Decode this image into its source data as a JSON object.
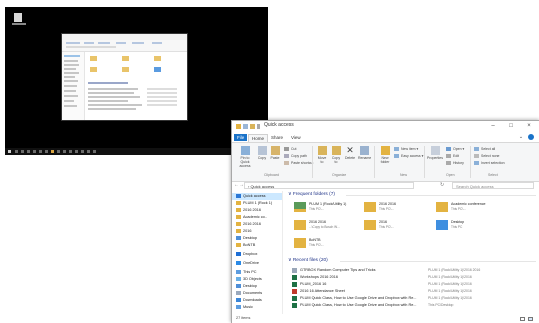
{
  "window": {
    "title": "Quick access",
    "tabs": [
      "File",
      "Home",
      "Share",
      "View"
    ],
    "controls": [
      "–",
      "□",
      "×"
    ]
  },
  "ribbon": {
    "clipboard": {
      "group_label": "Clipboard",
      "pin": "Pin to Quick access",
      "copy": "Copy",
      "paste": "Paste",
      "cut": "Cut",
      "copy_path": "Copy path",
      "paste_shortcut": "Paste shortcut"
    },
    "organize": {
      "group_label": "Organize",
      "move_to": "Move to",
      "copy_to": "Copy to",
      "delete": "Delete",
      "rename": "Rename"
    },
    "new": {
      "group_label": "New",
      "new_folder": "New folder",
      "new_item": "New item ▾",
      "easy_access": "Easy access ▾"
    },
    "open": {
      "group_label": "Open",
      "properties": "Properties",
      "open": "Open ▾",
      "edit": "Edit",
      "history": "History"
    },
    "select": {
      "group_label": "Select",
      "select_all": "Select all",
      "select_none": "Select none",
      "invert": "Invert selection"
    }
  },
  "address": {
    "path": "›  Quick access",
    "search_placeholder": "Search Quick access"
  },
  "nav": {
    "items": [
      {
        "label": "Quick access",
        "selected": true
      },
      {
        "label": "PLUM 1 (Rock 1)"
      },
      {
        "label": "2016 2016"
      },
      {
        "label": "Academic co.."
      },
      {
        "label": "2016 2016"
      },
      {
        "label": "2016"
      },
      {
        "label": "Desktop"
      },
      {
        "label": "BoNTB"
      },
      {
        "label": "Dropbox"
      },
      {
        "label": "OneDrive"
      },
      {
        "label": "This PC"
      },
      {
        "label": "3D Objects"
      },
      {
        "label": "Desktop"
      },
      {
        "label": "Documents"
      },
      {
        "label": "Downloads"
      },
      {
        "label": "Music"
      }
    ]
  },
  "frequent": {
    "heading": "∨  Frequent folders (7)",
    "tiles": [
      {
        "name": "PLUM 1 (Rock/Utility 1)",
        "sub": "This PC\\..."
      },
      {
        "name": "2016 2016",
        "sub": "This PC\\..."
      },
      {
        "name": "Academic conference",
        "sub": "This PC\\..."
      },
      {
        "name": "2016 2016",
        "sub": "...\\Copy to Bosch W..."
      },
      {
        "name": "2016",
        "sub": "This PC\\..."
      },
      {
        "name": "Desktop",
        "sub": "This PC"
      },
      {
        "name": "BoNTB",
        "sub": "This PC\\..."
      }
    ]
  },
  "recent": {
    "heading": "∨  Recent files (20)",
    "rows": [
      {
        "name": "GTRBOX Random Computer Tips and Tricks",
        "loc": "PLUM 1 (Rock/Utility 1)\\2016 2016"
      },
      {
        "name": "Workshops 2016 2016",
        "loc": "PLUM 1 (Rock/Utility 1)\\2016"
      },
      {
        "name": "PLUM_2016 16",
        "loc": "PLUM 1 (Rock/Utility 1)\\2016"
      },
      {
        "name": "2016 16 Attendance Sheet",
        "loc": "PLUM 1 (Rock/Utility 1)\\2016"
      },
      {
        "name": "PLUM Quick Class, How to Use Google Drive and Dropbox with Re...",
        "loc": "PLUM 1 (Rock/Utility 1)\\2016"
      },
      {
        "name": "PLUM Quick Class, How to Use Google Drive and Dropbox with Re...",
        "loc": "This PC\\Desktop"
      }
    ]
  },
  "status": {
    "items": "27 items"
  },
  "colors": {
    "accent": "#1a73c9",
    "folder": "#e9c46a",
    "excel": "#1e7145",
    "selection": "#cce8ff",
    "desktop_bg": "#000000"
  }
}
